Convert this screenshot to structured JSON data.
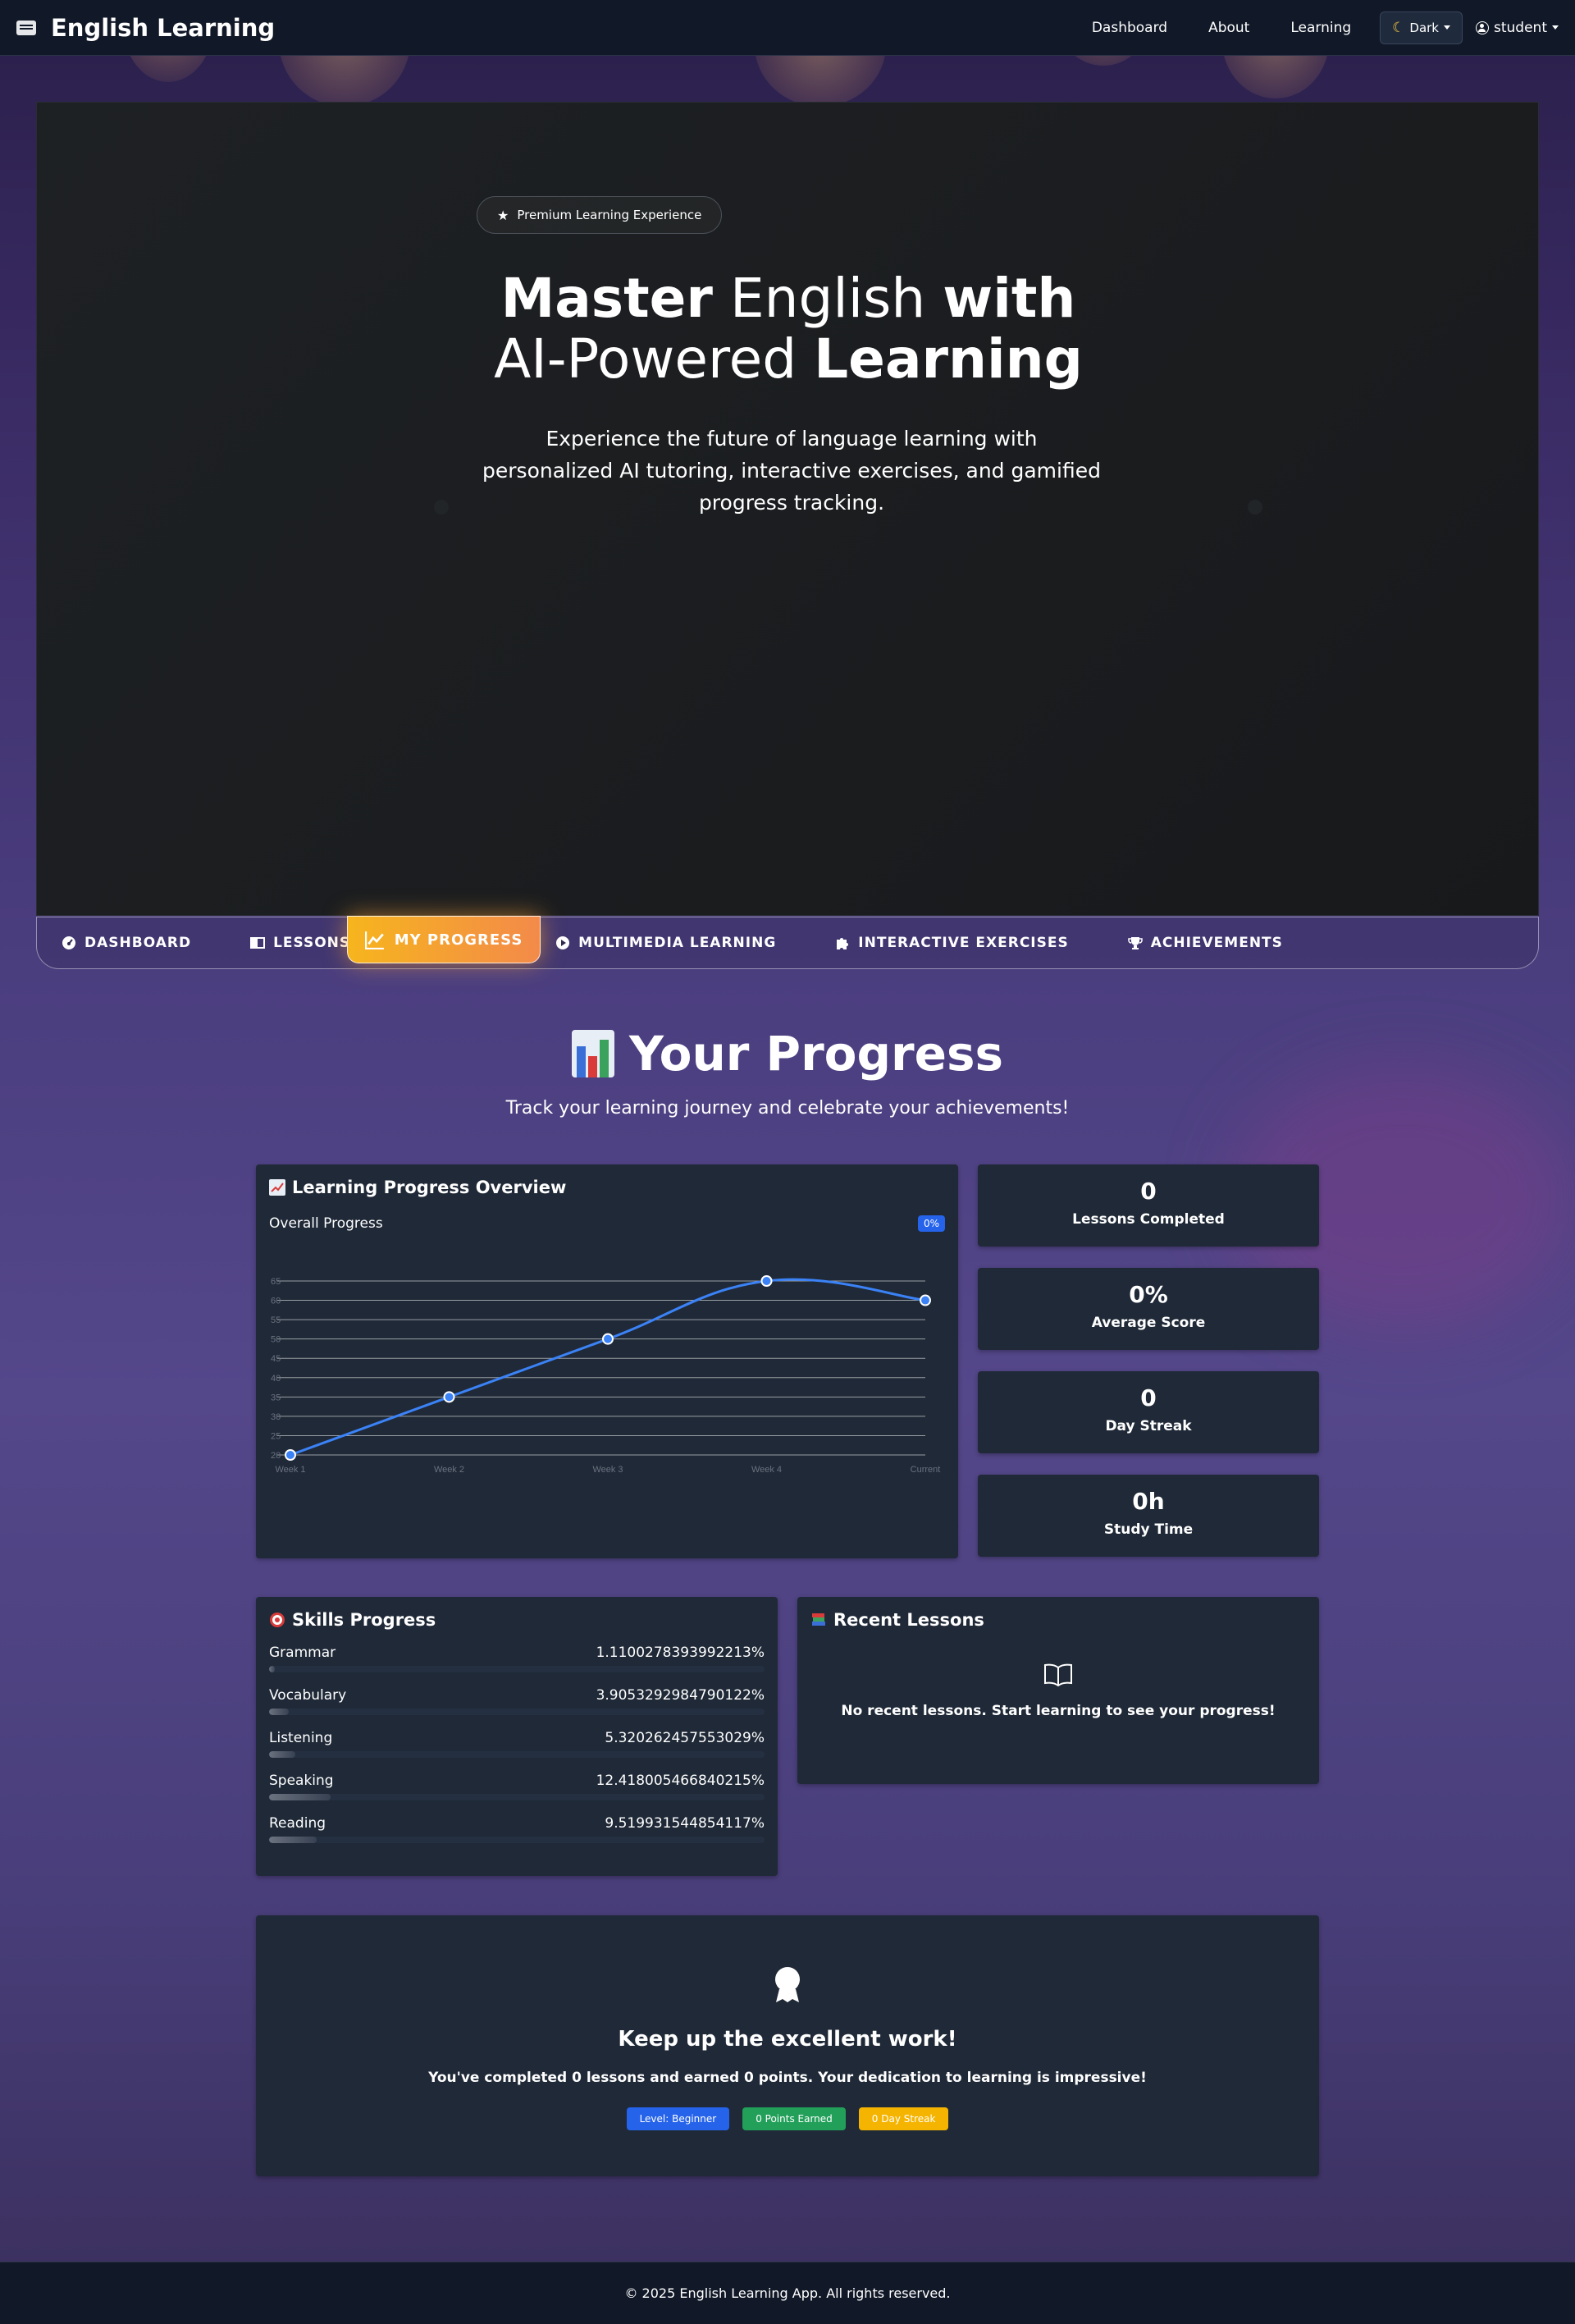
{
  "navbar": {
    "brand": "English Learning",
    "links": [
      "Dashboard",
      "About",
      "Learning"
    ],
    "theme_label": "Dark",
    "user_label": "student"
  },
  "hero": {
    "badge": "Premium Learning Experience",
    "title_line1": [
      "Master",
      " English ",
      "with"
    ],
    "title_line2": [
      "AI-Powered ",
      "Learning"
    ],
    "subtitle": "Experience the future of language learning with personalized AI tutoring, interactive exercises, and gamified progress tracking."
  },
  "tabs": {
    "items": [
      "DASHBOARD",
      "LESSONS",
      "MY PROGRESS",
      "MULTIMEDIA LEARNING",
      "INTERACTIVE EXERCISES",
      "ACHIEVEMENTS"
    ],
    "active": "MY PROGRESS"
  },
  "progress": {
    "title": "Your Progress",
    "subtitle": "Track your learning journey and celebrate your achievements!"
  },
  "overview": {
    "title": "Learning Progress Overview",
    "label": "Overall Progress",
    "pill": "0%"
  },
  "chart_data": {
    "type": "line",
    "categories": [
      "Week 1",
      "Week 2",
      "Week 3",
      "Week 4",
      "Current"
    ],
    "values": [
      20,
      35,
      50,
      65,
      60
    ],
    "yticks": [
      20,
      25,
      30,
      35,
      40,
      45,
      50,
      55,
      60,
      65
    ],
    "ylim": [
      20,
      65
    ],
    "grid": true,
    "line_color": "#3b82f6"
  },
  "stats": [
    {
      "value": "0",
      "label": "Lessons Completed"
    },
    {
      "value": "0%",
      "label": "Average Score"
    },
    {
      "value": "0",
      "label": "Day Streak"
    },
    {
      "value": "0h",
      "label": "Study Time"
    }
  ],
  "skills": {
    "title": "Skills Progress",
    "items": [
      {
        "name": "Grammar",
        "value": "1.1100278393992213%",
        "percent": 1.11
      },
      {
        "name": "Vocabulary",
        "value": "3.9053292984790122%",
        "percent": 3.91
      },
      {
        "name": "Listening",
        "value": "5.320262457553029%",
        "percent": 5.32
      },
      {
        "name": "Speaking",
        "value": "12.418005466840215%",
        "percent": 12.42
      },
      {
        "name": "Reading",
        "value": "9.519931544854117%",
        "percent": 9.52
      }
    ]
  },
  "recent": {
    "title": "Recent Lessons",
    "empty": "No recent lessons. Start learning to see your progress!"
  },
  "motivation": {
    "title": "Keep up the excellent work!",
    "text": "You've completed 0 lessons and earned 0 points. Your dedication to learning is impressive!",
    "badges": [
      {
        "label": "Level: Beginner",
        "color": "#2563eb"
      },
      {
        "label": "0 Points Earned",
        "color": "#22a05a"
      },
      {
        "label": "0 Day Streak",
        "color": "#f5b400"
      }
    ]
  },
  "footer": {
    "text": "© 2025 English Learning App. All rights reserved."
  }
}
